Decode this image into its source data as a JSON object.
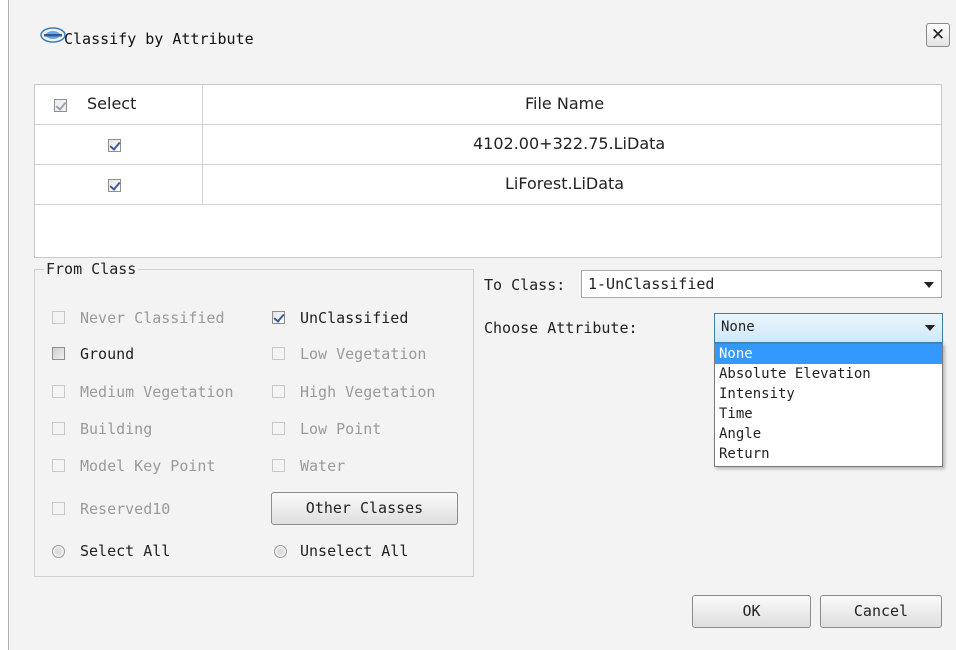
{
  "window": {
    "title": "Classify by Attribute",
    "close_glyph": "✕"
  },
  "table": {
    "headers": {
      "select": "Select",
      "file_name": "File Name"
    },
    "rows": [
      {
        "checked": true,
        "file_name": "4102.00+322.75.LiData"
      },
      {
        "checked": true,
        "file_name": "LiForest.LiData"
      }
    ]
  },
  "from_class": {
    "title": "From Class",
    "items": [
      {
        "label": "Never Classified",
        "checked": false,
        "enabled": false
      },
      {
        "label": "UnClassified",
        "checked": true,
        "enabled": true
      },
      {
        "label": "Ground",
        "checked": false,
        "enabled": true
      },
      {
        "label": "Low Vegetation",
        "checked": false,
        "enabled": false
      },
      {
        "label": "Medium Vegetation",
        "checked": false,
        "enabled": false
      },
      {
        "label": "High Vegetation",
        "checked": false,
        "enabled": false
      },
      {
        "label": "Building",
        "checked": false,
        "enabled": false
      },
      {
        "label": "Low Point",
        "checked": false,
        "enabled": false
      },
      {
        "label": "Model Key Point",
        "checked": false,
        "enabled": false
      },
      {
        "label": "Water",
        "checked": false,
        "enabled": false
      },
      {
        "label": "Reserved10",
        "checked": false,
        "enabled": false
      }
    ],
    "other_classes_button": "Other Classes",
    "select_all": "Select All",
    "unselect_all": "Unselect All"
  },
  "to_class": {
    "label": "To Class:",
    "value": "1-UnClassified"
  },
  "choose_attribute": {
    "label": "Choose Attribute:",
    "value": "None",
    "options": [
      "None",
      "Absolute Elevation",
      "Intensity",
      "Time",
      "Angle",
      "Return"
    ],
    "selected_index": 0
  },
  "buttons": {
    "ok": "OK",
    "cancel": "Cancel"
  },
  "colors": {
    "highlight": "#3399ff",
    "dialog_bg": "#f3f3f3",
    "check": "#3b5a99"
  },
  "icons": {
    "app": "lidar-logo-icon",
    "close": "close-icon"
  }
}
